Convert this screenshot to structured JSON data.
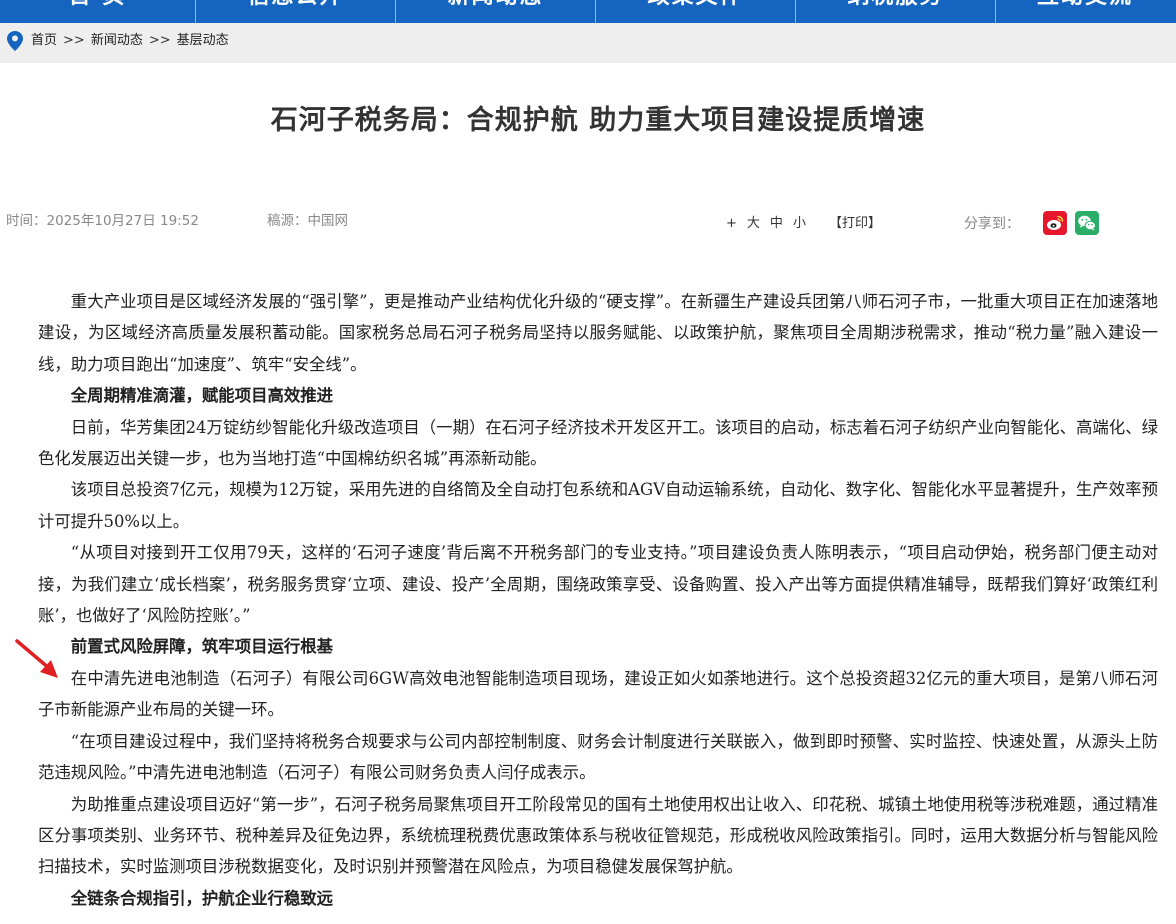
{
  "nav": {
    "items": [
      "首 页",
      "信息公开",
      "新闻动态",
      "政策文件",
      "纳税服务",
      "互动交流"
    ]
  },
  "breadcrumb": {
    "items": [
      "首页",
      "新闻动态",
      "基层动态"
    ],
    "separator": ">>"
  },
  "article": {
    "title": "石河子税务局：合规护航 助力重大项目建设提质增速",
    "time": "时间：2025年10月27日 19:52",
    "source": "稿源：中国网",
    "font_controls": [
      "+",
      "大",
      "中",
      "小"
    ],
    "print": "【打印】",
    "share_label": "分享到：",
    "paragraphs": [
      {
        "type": "p",
        "text": "重大产业项目是区域经济发展的“强引擎”，更是推动产业结构优化升级的“硬支撑”。在新疆生产建设兵团第八师石河子市，一批重大项目正在加速落地建设，为区域经济高质量发展积蓄动能。国家税务总局石河子税务局坚持以服务赋能、以政策护航，聚焦项目全周期涉税需求，推动“税力量”融入建设一线，助力项目跑出“加速度”、筑牢“安全线”。"
      },
      {
        "type": "sub",
        "text": "全周期精准滴灌，赋能项目高效推进"
      },
      {
        "type": "p",
        "text": "日前，华芳集团24万锭纺纱智能化升级改造项目（一期）在石河子经济技术开发区开工。该项目的启动，标志着石河子纺织产业向智能化、高端化、绿色化发展迈出关键一步，也为当地打造“中国棉纺织名城”再添新动能。"
      },
      {
        "type": "p",
        "text": "该项目总投资7亿元，规模为12万锭，采用先进的自络筒及全自动打包系统和AGV自动运输系统，自动化、数字化、智能化水平显著提升，生产效率预计可提升50%以上。"
      },
      {
        "type": "p",
        "text": "“从项目对接到开工仅用79天，这样的‘石河子速度’背后离不开税务部门的专业支持。”项目建设负责人陈明表示，“项目启动伊始，税务部门便主动对接，为我们建立‘成长档案’，税务服务贯穿‘立项、建设、投产’全周期，围绕政策享受、设备购置、投入产出等方面提供精准辅导，既帮我们算好‘政策红利账’，也做好了‘风险防控账’。”"
      },
      {
        "type": "sub",
        "text": "前置式风险屏障，筑牢项目运行根基"
      },
      {
        "type": "p",
        "text": "在中清先进电池制造（石河子）有限公司6GW高效电池智能制造项目现场，建设正如火如荼地进行。这个总投资超32亿元的重大项目，是第八师石河子市新能源产业布局的关键一环。"
      },
      {
        "type": "p",
        "text": "“在项目建设过程中，我们坚持将税务合规要求与公司内部控制制度、财务会计制度进行关联嵌入，做到即时预警、实时监控、快速处置，从源头上防范违规风险。”中清先进电池制造（石河子）有限公司财务负责人闫仔成表示。"
      },
      {
        "type": "p",
        "text": "为助推重点建设项目迈好“第一步”，石河子税务局聚焦项目开工阶段常见的国有土地使用权出让收入、印花税、城镇土地使用税等涉税难题，通过精准区分事项类别、业务环节、税种差异及征免边界，系统梳理税费优惠政策体系与税收征管规范，形成税收风险政策指引。同时，运用大数据分析与智能风险扫描技术，实时监测项目涉税数据变化，及时识别并预警潜在风险点，为项目稳健发展保驾护航。"
      },
      {
        "type": "sub",
        "text": "全链条合规指引，护航企业行稳致远"
      }
    ]
  },
  "colors": {
    "nav_bg": "#1565c0",
    "crumb_bg": "#eeeeee",
    "pin": "#1565c0",
    "weibo": "#e6162d",
    "wechat": "#2aae67",
    "annotation_arrow": "#e02020"
  }
}
